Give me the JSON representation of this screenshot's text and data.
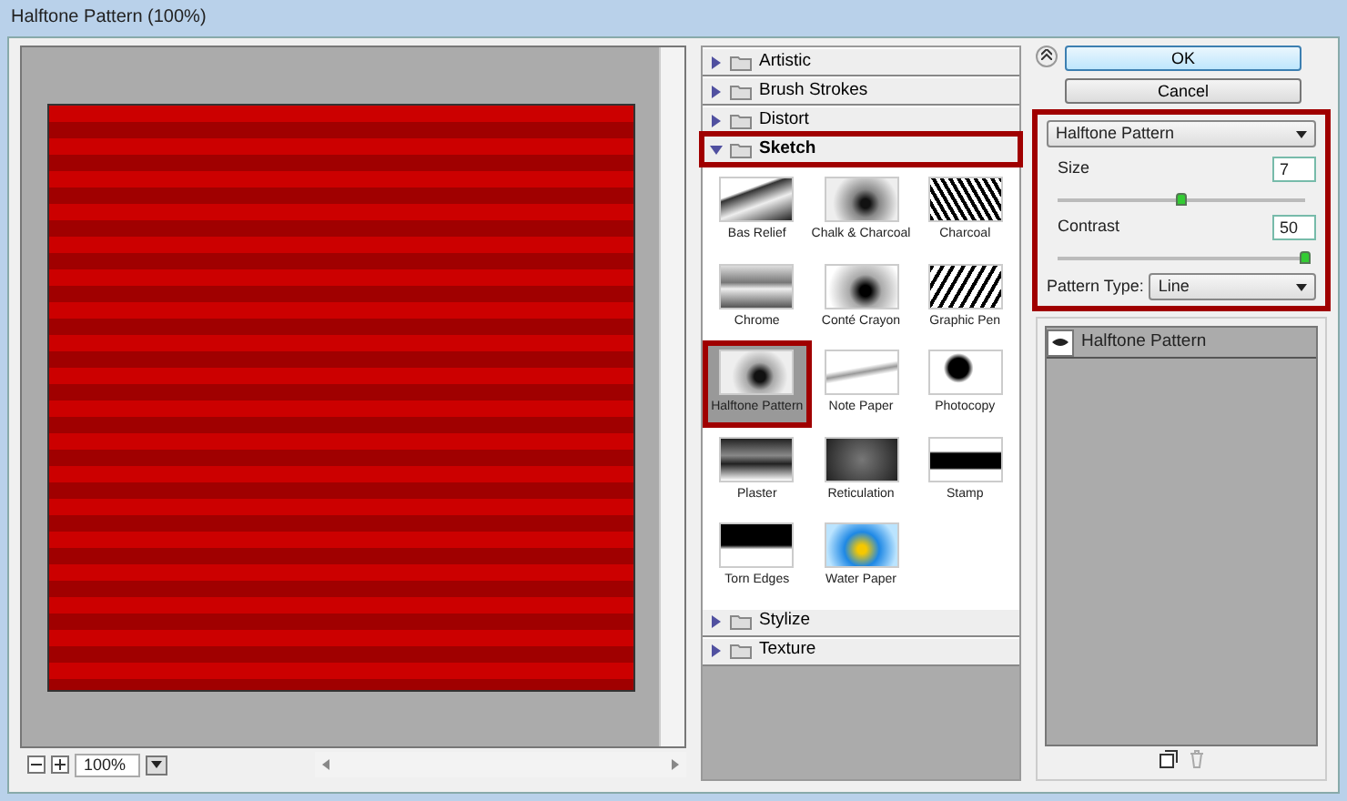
{
  "window": {
    "title": "Halftone Pattern (100%)"
  },
  "preview": {
    "zoom": "100%"
  },
  "categories_before": [
    {
      "label": "Artistic",
      "expanded": false
    },
    {
      "label": "Brush Strokes",
      "expanded": false
    },
    {
      "label": "Distort",
      "expanded": false
    }
  ],
  "open_category": {
    "label": "Sketch",
    "expanded": true,
    "highlighted": true
  },
  "filters": [
    {
      "label": "Bas Relief",
      "selected": false
    },
    {
      "label": "Chalk & Charcoal",
      "selected": false
    },
    {
      "label": "Charcoal",
      "selected": false
    },
    {
      "label": "Chrome",
      "selected": false
    },
    {
      "label": "Conté Crayon",
      "selected": false
    },
    {
      "label": "Graphic Pen",
      "selected": false
    },
    {
      "label": "Halftone Pattern",
      "selected": true,
      "highlighted": true
    },
    {
      "label": "Note Paper",
      "selected": false
    },
    {
      "label": "Photocopy",
      "selected": false
    },
    {
      "label": "Plaster",
      "selected": false
    },
    {
      "label": "Reticulation",
      "selected": false
    },
    {
      "label": "Stamp",
      "selected": false
    },
    {
      "label": "Torn Edges",
      "selected": false
    },
    {
      "label": "Water Paper",
      "selected": false
    }
  ],
  "categories_after": [
    {
      "label": "Stylize",
      "expanded": false
    },
    {
      "label": "Texture",
      "expanded": false
    }
  ],
  "buttons": [
    {
      "label": "OK",
      "default": true
    },
    {
      "label": "Cancel",
      "default": false
    }
  ],
  "settings": {
    "highlighted": true,
    "filter": "Halftone Pattern",
    "sliders": [
      {
        "label": "Size",
        "value": "7",
        "level": 0.5
      },
      {
        "label": "Contrast",
        "value": "50",
        "level": 1.0
      }
    ],
    "pattern_type": {
      "label": "Pattern Type:",
      "value": "Line"
    }
  },
  "layers": [
    {
      "label": "Halftone Pattern",
      "visible": true
    }
  ]
}
